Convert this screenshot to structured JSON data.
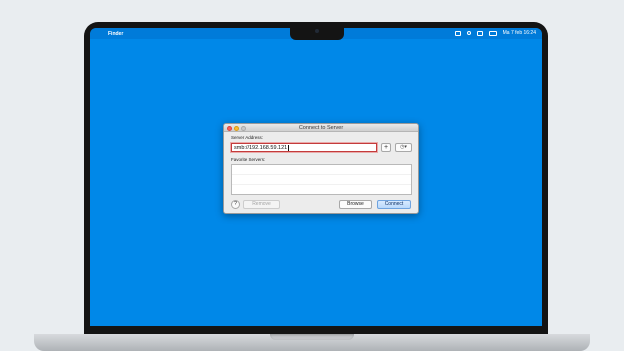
{
  "menubar": {
    "apple_glyph": "",
    "app_name": "Finder",
    "clock": "Ma 7 feb  16:24"
  },
  "dialog": {
    "title": "Connect to Server",
    "server_address_label": "Server Address:",
    "server_address_value": "smb://192.168.59.121",
    "add_button": "+",
    "recent_button": "◷▾",
    "favorite_servers_label": "Favorite Servers:",
    "help_button": "?",
    "remove_button": "Remove",
    "browse_button": "Browse",
    "connect_button": "Connect"
  },
  "colors": {
    "desktop": "#0088e8",
    "close": "#fc5f57",
    "minimize": "#fdbc2e",
    "field_error_border": "#c43b3b"
  }
}
